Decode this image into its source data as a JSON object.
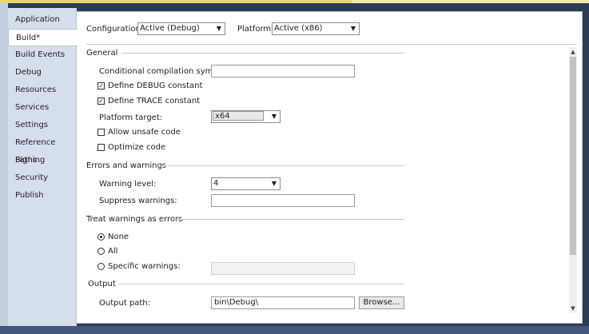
{
  "sidebar": {
    "items": [
      {
        "label": "Application"
      },
      {
        "label": "Build*"
      },
      {
        "label": "Build Events"
      },
      {
        "label": "Debug"
      },
      {
        "label": "Resources"
      },
      {
        "label": "Services"
      },
      {
        "label": "Settings"
      },
      {
        "label": "Reference Paths"
      },
      {
        "label": "Signing"
      },
      {
        "label": "Security"
      },
      {
        "label": "Publish"
      }
    ],
    "selected_index": 1
  },
  "toolbar": {
    "configuration_label": "Configuration:",
    "configuration_value": "Active (Debug)",
    "platform_label": "Platform:",
    "platform_value": "Active (x86)"
  },
  "general": {
    "header": "General",
    "conditional_symbols_label": "Conditional compilation symbols:",
    "conditional_symbols_value": "",
    "define_debug_label": "Define DEBUG constant",
    "define_debug_checked": true,
    "define_trace_label": "Define TRACE constant",
    "define_trace_checked": true,
    "platform_target_label": "Platform target:",
    "platform_target_value": "x64",
    "allow_unsafe_label": "Allow unsafe code",
    "allow_unsafe_checked": false,
    "optimize_label": "Optimize code",
    "optimize_checked": false
  },
  "errors": {
    "header": "Errors and warnings",
    "warning_level_label": "Warning level:",
    "warning_level_value": "4",
    "suppress_label": "Suppress warnings:",
    "suppress_value": ""
  },
  "treat": {
    "header": "Treat warnings as errors",
    "options": [
      "None",
      "All",
      "Specific warnings:"
    ],
    "selected": "None",
    "specific_value": ""
  },
  "output": {
    "header": "Output",
    "path_label": "Output path:",
    "path_value": "bin\\Debug\\",
    "browse_label": "Browse..."
  },
  "icons": {
    "check": "✓",
    "dropdown": "▼",
    "scroll_up": "▲",
    "scroll_down": "▼"
  }
}
